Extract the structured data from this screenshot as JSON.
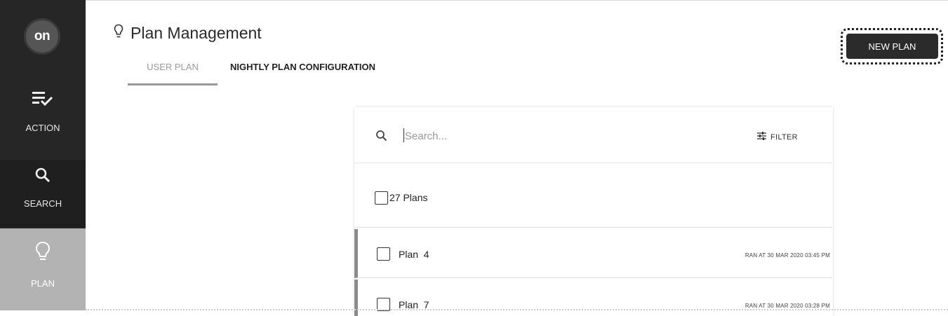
{
  "app": {
    "logo_text": "on",
    "page_title": "Plan Management",
    "page_icon": "lightbulb-icon"
  },
  "sidebar": {
    "items": [
      {
        "label": "ACTION",
        "icon": "action-list-check-icon"
      },
      {
        "label": "SEARCH",
        "icon": "search-icon"
      },
      {
        "label": "PLAN",
        "icon": "lightbulb-icon",
        "active": true
      }
    ]
  },
  "tabs": [
    {
      "label": "USER PLAN",
      "active": true
    },
    {
      "label": "NIGHTLY PLAN CONFIGURATION",
      "active": false
    }
  ],
  "toolbar": {
    "new_plan_label": "NEW PLAN"
  },
  "panel": {
    "search": {
      "placeholder": "Search...",
      "value": "",
      "icon": "search-icon"
    },
    "filter": {
      "label": "FILTER",
      "icon": "sliders-icon"
    },
    "count_label": "27 Plans",
    "plans": [
      {
        "name": "Plan  4",
        "status": "RAN AT 30 MAR 2020 03:45 PM",
        "checked": false
      },
      {
        "name": "Plan  7",
        "status": "RAN AT 30 MAR 2020 03:28 PM",
        "checked": false
      }
    ]
  },
  "colors": {
    "sidebar_bg": "#262626",
    "sidebar_active_bg": "#b3b3b3",
    "primary_button": "#2b2b2b",
    "row_accent": "#8c8c8c"
  }
}
